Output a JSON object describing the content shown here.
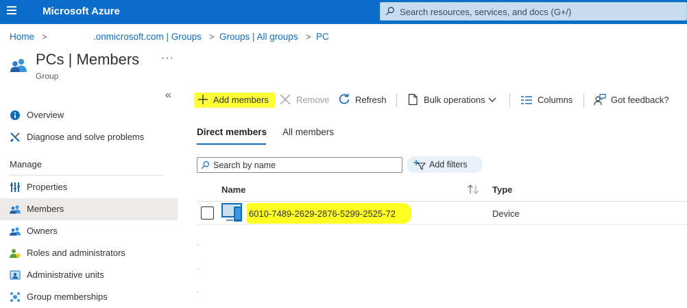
{
  "topbar": {
    "brand": "Microsoft Azure",
    "search_placeholder": "Search resources, services, and docs (G+/)"
  },
  "breadcrumb": {
    "items": [
      "Home",
      ".onmicrosoft.com | Groups",
      "Groups | All groups",
      "PC"
    ],
    "separator": ">"
  },
  "page": {
    "title": "PCs | Members",
    "subtitle": "Group",
    "more": "···"
  },
  "sidebar": {
    "collapse": "«",
    "items": [
      {
        "label": "Overview",
        "icon": "info-icon"
      },
      {
        "label": "Diagnose and solve problems",
        "icon": "tools-icon"
      }
    ],
    "section_label": "Manage",
    "manage_items": [
      {
        "label": "Properties",
        "icon": "properties-icon"
      },
      {
        "label": "Members",
        "icon": "members-icon",
        "active": true
      },
      {
        "label": "Owners",
        "icon": "owners-icon"
      },
      {
        "label": "Roles and administrators",
        "icon": "roles-icon"
      },
      {
        "label": "Administrative units",
        "icon": "admin-units-icon"
      },
      {
        "label": "Group memberships",
        "icon": "group-memberships-icon"
      }
    ]
  },
  "toolbar": {
    "add_members": "Add members",
    "remove": "Remove",
    "refresh": "Refresh",
    "bulk_operations": "Bulk operations",
    "columns": "Columns",
    "feedback": "Got feedback?"
  },
  "tabs": {
    "direct": "Direct members",
    "all": "All members"
  },
  "filters": {
    "search_placeholder": "Search by name",
    "add_filters": "Add filters"
  },
  "grid": {
    "columns": {
      "name": "Name",
      "type": "Type"
    },
    "rows": [
      {
        "name": "6010-7489-2629-2876-5299-2525-72",
        "type": "Device"
      }
    ]
  },
  "colors": {
    "topbar": "#0a6cc9",
    "accent": "#0f6cbd",
    "highlight": "#ffff22"
  }
}
